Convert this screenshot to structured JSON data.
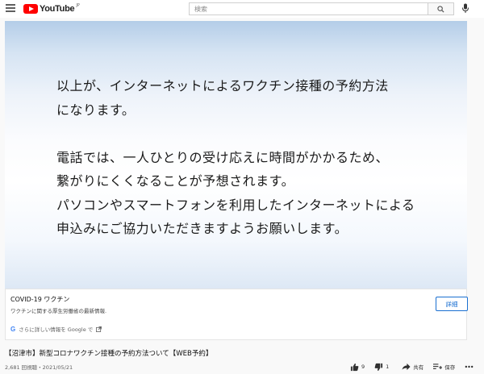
{
  "header": {
    "logo_text": "YouTube",
    "logo_region": "JP",
    "search_placeholder": "検索"
  },
  "video": {
    "lines_para1": [
      "以上が、インターネットによるワクチン接種の予約方法",
      "になります。"
    ],
    "lines_para2": [
      "電話では、一人ひとりの受け応えに時間がかかるため、",
      "繋がりにくくなることが予想されます。",
      "パソコンやスマートフォンを利用したインターネットによる",
      "申込みにご協力いただきますようお願いします。"
    ]
  },
  "info_panel": {
    "title": "COVID-19 ワクチン",
    "subtitle": "ワクチンに関する厚生労働省の最新情報.",
    "button_label": "詳細",
    "footer": "さらに詳しい情報を Google で"
  },
  "video_title": "【沼津市】新型コロナワクチン接種の予約方法ついて【WEB予約】",
  "video_meta": "2,681 回視聴・2021/05/21",
  "actions": {
    "like_count": "9",
    "dislike_count": "1",
    "share_label": "共有",
    "save_label": "保存"
  },
  "colors": {
    "brand_red": "#ff0000",
    "link_blue": "#1a6fd1"
  }
}
